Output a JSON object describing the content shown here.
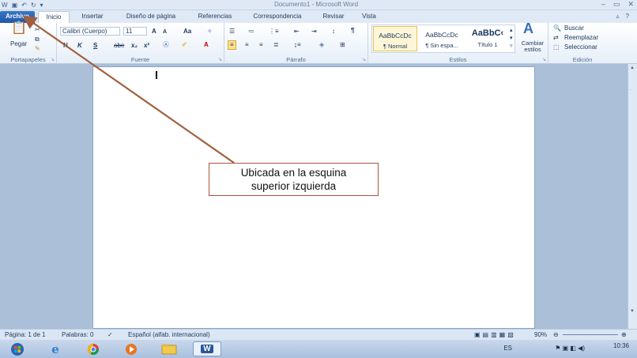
{
  "window": {
    "title": "Documento1 - Microsoft Word"
  },
  "tabs": [
    {
      "label": "Archivo"
    },
    {
      "label": "Inicio"
    },
    {
      "label": "Insertar"
    },
    {
      "label": "Diseño de página"
    },
    {
      "label": "Referencias"
    },
    {
      "label": "Correspondencia"
    },
    {
      "label": "Revisar"
    },
    {
      "label": "Vista"
    }
  ],
  "ribbon": {
    "clipboard": {
      "paste_label": "Pegar",
      "group_label": "Portapapeles"
    },
    "font": {
      "font_name": "Calibri (Cuerpo)",
      "font_size": "11",
      "grow": "A",
      "shrink": "A",
      "case": "Aa",
      "bold": "N",
      "italic": "K",
      "underline": "S",
      "strike": "abe",
      "subscript": "x₂",
      "superscript": "x²",
      "group_label": "Fuente"
    },
    "paragraph": {
      "group_label": "Párrafo"
    },
    "styles": {
      "items": [
        {
          "sample": "AaBbCcDc",
          "name": "¶ Normal"
        },
        {
          "sample": "AaBbCcDc",
          "name": "¶ Sin espa..."
        },
        {
          "sample": "AaBbC‹",
          "name": "Título 1"
        }
      ],
      "change_styles_label": "Cambiar estilos",
      "group_label": "Estilos"
    },
    "editing": {
      "find": "Buscar",
      "replace": "Reemplazar",
      "select": "Seleccionar",
      "group_label": "Edición"
    }
  },
  "callout": {
    "line1": "Ubicada en la esquina",
    "line2": "superior izquierda"
  },
  "status": {
    "page": "Página: 1 de 1",
    "words": "Palabras: 0",
    "language": "Español (alfab. internacional)",
    "zoom": "90%"
  },
  "taskbar": {
    "lang": "ES",
    "time": "10:36"
  },
  "colors": {
    "file_tab": "#2a64b4",
    "callout_border": "#b0513b",
    "arrow": "#a0603f",
    "workspace": "#abbfd9"
  }
}
